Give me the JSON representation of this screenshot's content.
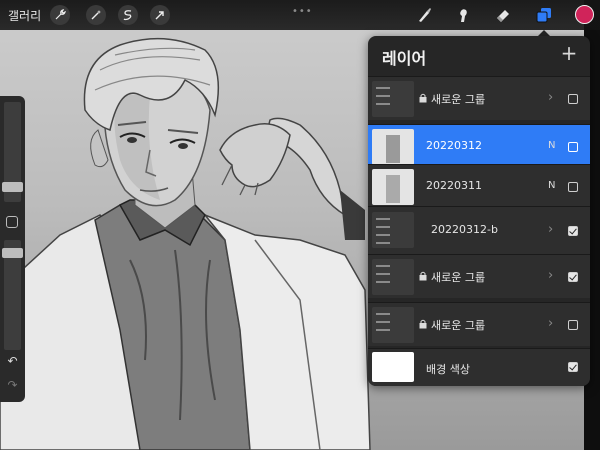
{
  "top_bar": {
    "gallery_label": "갤러리",
    "left_tools": [
      {
        "icon": "wrench-icon"
      },
      {
        "icon": "magic-wand-icon"
      },
      {
        "icon": "selection-icon"
      },
      {
        "icon": "transform-arrow-icon"
      }
    ],
    "right_tools": [
      {
        "icon": "brush-icon"
      },
      {
        "icon": "smudge-icon"
      },
      {
        "icon": "eraser-icon"
      },
      {
        "icon": "layers-icon"
      }
    ],
    "color": "#d0245a",
    "accent": "#2f7cf6"
  },
  "sidebar": {
    "undo_glyph": "↶",
    "redo_glyph": "↷"
  },
  "layers": {
    "title": "레이어",
    "add_glyph": "+",
    "rows": [
      {
        "name": "새로운 그룹",
        "type": "group",
        "locked": true,
        "visible": false,
        "selected": false
      },
      {
        "name": "20220312",
        "type": "layer",
        "mode": "N",
        "visible": false,
        "selected": true
      },
      {
        "name": "20220311",
        "type": "layer",
        "mode": "N",
        "visible": false,
        "selected": false
      },
      {
        "name": "20220312-b",
        "type": "group",
        "locked": false,
        "visible": true,
        "selected": false
      },
      {
        "name": "새로운 그룹",
        "type": "group",
        "locked": true,
        "visible": true,
        "selected": false
      },
      {
        "name": "새로운 그룹",
        "type": "group",
        "locked": true,
        "visible": false,
        "selected": false
      },
      {
        "name": "배경 색상",
        "type": "background",
        "visible": true,
        "selected": false
      }
    ]
  }
}
